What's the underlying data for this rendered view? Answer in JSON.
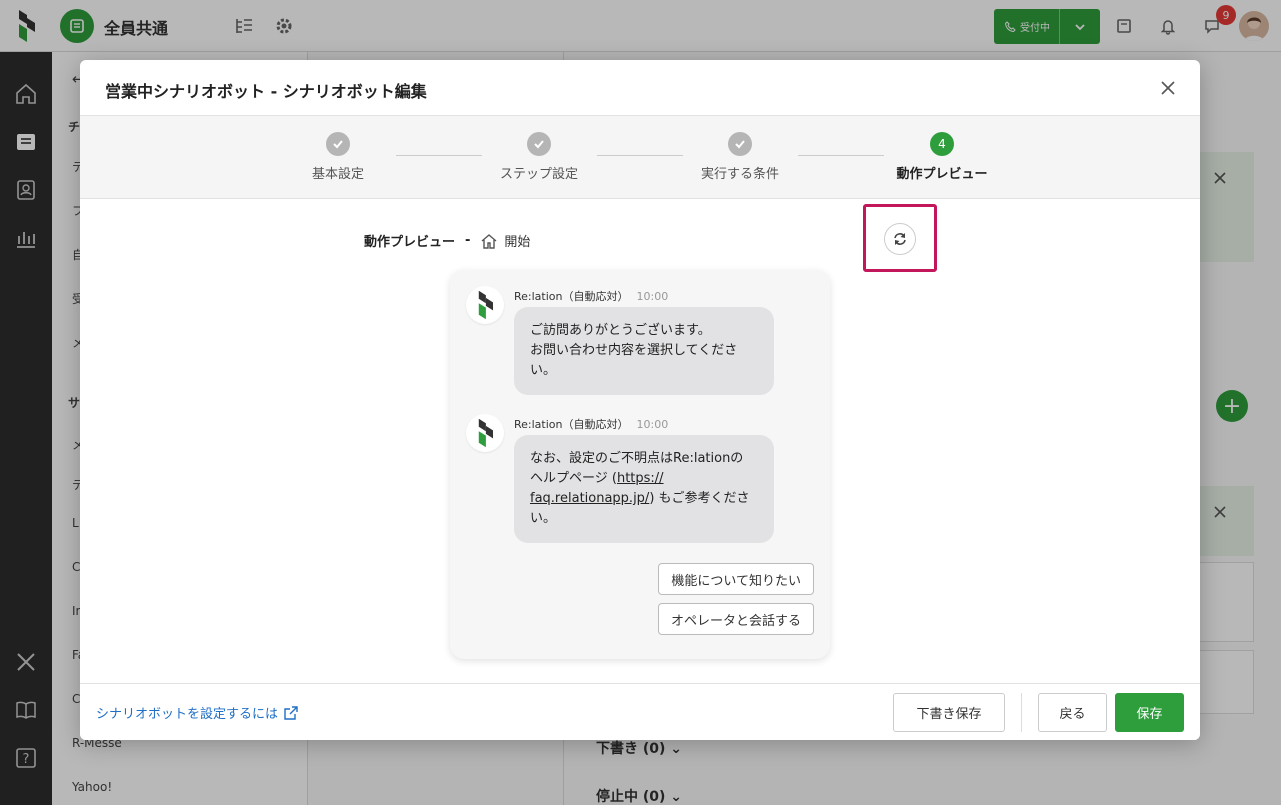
{
  "app": {
    "inbox_name": "全員共通",
    "reception_label": "受付中",
    "notification_count": "9",
    "sidebar": {
      "items": [
        "チ",
        "テ",
        "フ",
        "自",
        "受",
        "メ",
        "サ",
        "メ",
        "テ",
        "L",
        "C",
        "In",
        "Fa",
        "C",
        "R-Messe",
        "Yahoo!"
      ]
    },
    "main": {
      "draft_section": "下書き (0)",
      "stopped_section": "停止中 (0)"
    }
  },
  "modal": {
    "title": "営業中シナリオボット - シナリオボット編集",
    "steps": [
      {
        "number": "1",
        "label": "基本設定",
        "status": "done"
      },
      {
        "number": "2",
        "label": "ステップ設定",
        "status": "done"
      },
      {
        "number": "3",
        "label": "実行する条件",
        "status": "done"
      },
      {
        "number": "4",
        "label": "動作プレビュー",
        "status": "active"
      }
    ],
    "preview": {
      "title": "動作プレビュー",
      "separator": "-",
      "location": "開始"
    },
    "chat": {
      "messages": [
        {
          "sender": "Re:lation（自動応対）",
          "time": "10:00",
          "lines": [
            "ご訪問ありがとうございます。",
            "お問い合わせ内容を選択してくださ",
            "い。"
          ]
        },
        {
          "sender": "Re:lation（自動応対）",
          "time": "10:00",
          "text_before": "なお、設定のご不明点はRe:lationの",
          "text_line2": "ヘルプページ (",
          "link_part1": "https://",
          "link_part2": "faq.relationapp.jp/",
          "text_after": ") もご参考くださ",
          "text_end": "い。"
        }
      ],
      "choices": [
        "機能について知りたい",
        "オペレータと会話する"
      ]
    },
    "footer": {
      "help_link": "シナリオボットを設定するには",
      "draft_save": "下書き保存",
      "back": "戻る",
      "save": "保存"
    }
  },
  "colors": {
    "brand_green": "#2e9d3c",
    "highlight": "#c2185b",
    "link": "#1f6fc5"
  }
}
